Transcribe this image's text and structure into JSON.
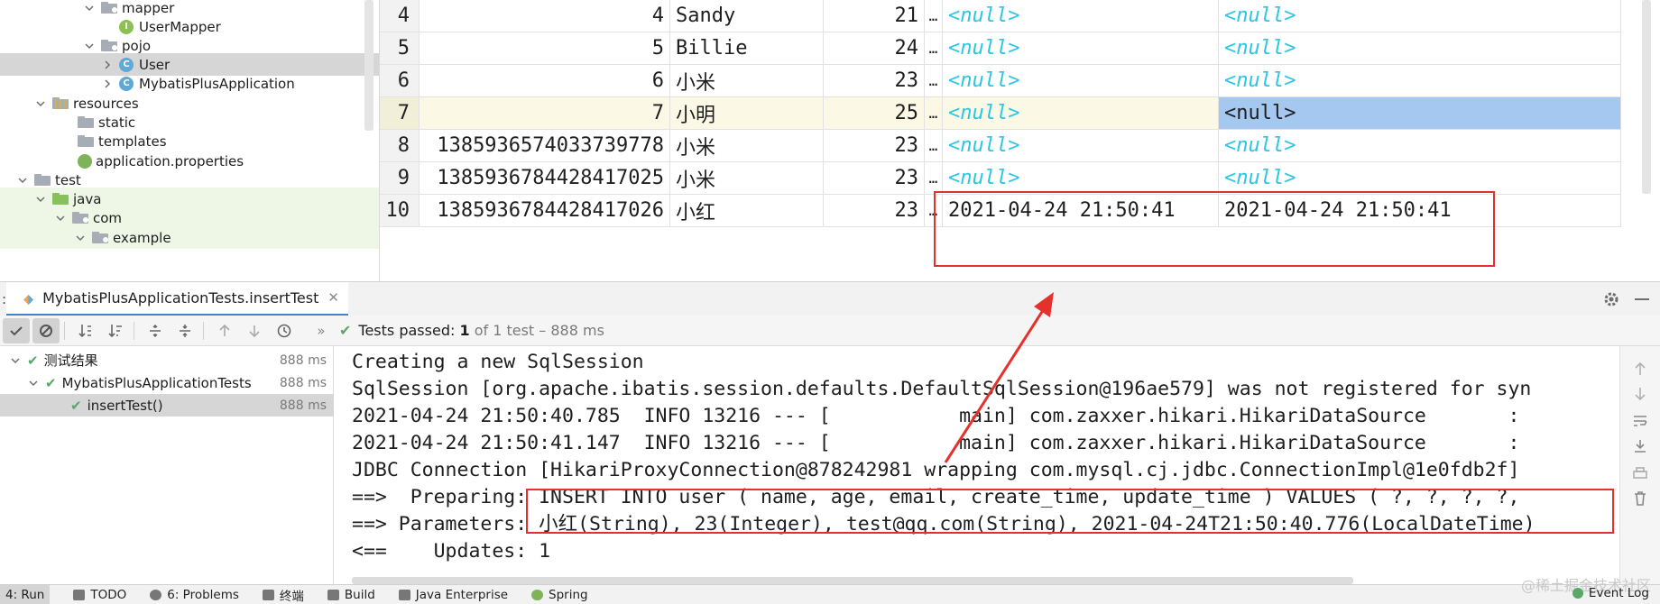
{
  "project_tree": {
    "items": [
      {
        "label": "mapper",
        "icon": "folder-package-icon",
        "expanded": true
      },
      {
        "label": "UserMapper",
        "icon": "interface-icon"
      },
      {
        "label": "pojo",
        "icon": "folder-package-icon",
        "expanded": true
      },
      {
        "label": "User",
        "icon": "class-icon",
        "selected": true
      },
      {
        "label": "MybatisPlusApplication",
        "icon": "spring-boot-class-icon"
      },
      {
        "label": "resources",
        "icon": "resources-folder-icon",
        "expanded": true
      },
      {
        "label": "static",
        "icon": "folder-icon"
      },
      {
        "label": "templates",
        "icon": "folder-icon"
      },
      {
        "label": "application.properties",
        "icon": "properties-file-icon"
      },
      {
        "label": "test",
        "icon": "folder-icon",
        "expanded": true
      },
      {
        "label": "java",
        "icon": "test-source-folder-icon",
        "expanded": true
      },
      {
        "label": "com",
        "icon": "folder-package-icon",
        "expanded": true
      },
      {
        "label": "example",
        "icon": "folder-package-icon"
      }
    ]
  },
  "grid": {
    "rows": [
      {
        "n": "4",
        "id": "4",
        "name": "Sandy",
        "age": "21",
        "email": "…",
        "create_time": "<null>",
        "update_time": "<null>"
      },
      {
        "n": "5",
        "id": "5",
        "name": "Billie",
        "age": "24",
        "email": "…",
        "create_time": "<null>",
        "update_time": "<null>"
      },
      {
        "n": "6",
        "id": "6",
        "name": "小米",
        "age": "23",
        "email": "…",
        "create_time": "<null>",
        "update_time": "<null>"
      },
      {
        "n": "7",
        "id": "7",
        "name": "小明",
        "age": "25",
        "email": "…",
        "create_time": "<null>",
        "update_time": "<null>"
      },
      {
        "n": "8",
        "id": "1385936574033739778",
        "name": "小米",
        "age": "23",
        "email": "…",
        "create_time": "<null>",
        "update_time": "<null>"
      },
      {
        "n": "9",
        "id": "1385936784428417025",
        "name": "小米",
        "age": "23",
        "email": "…",
        "create_time": "<null>",
        "update_time": "<null>"
      },
      {
        "n": "10",
        "id": "1385936784428417026",
        "name": "小红",
        "age": "23",
        "email": "…",
        "create_time": "2021-04-24 21:50:41",
        "update_time": "2021-04-24 21:50:41"
      }
    ]
  },
  "run": {
    "prefix": ":",
    "tab_label": "MybatisPlusApplicationTests.insertTest",
    "status_prefix": "Tests passed:",
    "status_count": "1",
    "status_suffix": "of 1 test – 888 ms"
  },
  "test_tree": [
    {
      "label": "测试结果",
      "duration": "888 ms"
    },
    {
      "label": "MybatisPlusApplicationTests",
      "duration": "888 ms"
    },
    {
      "label": "insertTest()",
      "duration": "888 ms",
      "selected": true
    }
  ],
  "console": {
    "lines": [
      "Creating a new SqlSession",
      "SqlSession [org.apache.ibatis.session.defaults.DefaultSqlSession@196ae579] was not registered for syn",
      "2021-04-24 21:50:40.785  INFO 13216 --- [           main] com.zaxxer.hikari.HikariDataSource       :",
      "2021-04-24 21:50:41.147  INFO 13216 --- [           main] com.zaxxer.hikari.HikariDataSource       :",
      "JDBC Connection [HikariProxyConnection@878242981 wrapping com.mysql.cj.jdbc.ConnectionImpl@1e0fdb2f]",
      "==>  Preparing: INSERT INTO user ( name, age, email, create_time, update_time ) VALUES ( ?, ?, ?, ?,",
      "==> Parameters: 小红(String), 23(Integer), test@qq.com(String), 2021-04-24T21:50:40.776(LocalDateTime)",
      "<==    Updates: 1"
    ]
  },
  "bottom_bar": {
    "items": [
      "4: Run",
      "TODO",
      "6: Problems",
      "终端",
      "Build",
      "Java Enterprise",
      "Spring"
    ],
    "event_log": "Event Log",
    "watermark": "@稀土掘金技术社区"
  },
  "colors": {
    "null_text": "#2bc6e5",
    "selected_cell": "#a5c8f0",
    "annotation_red": "#e5312c",
    "pass_green": "#59a869"
  }
}
